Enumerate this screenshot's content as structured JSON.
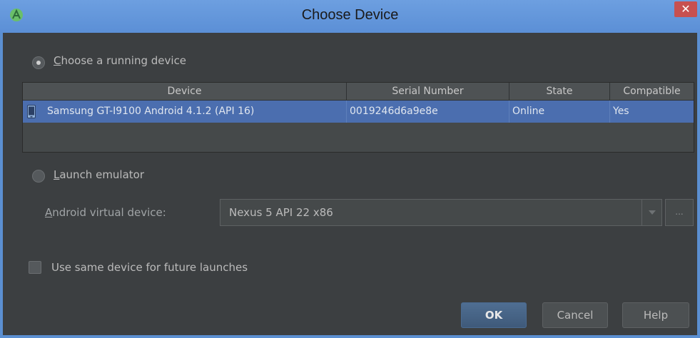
{
  "window": {
    "title": "Choose Device",
    "close_glyph": "✕",
    "accent_color": "#5b8fd1"
  },
  "running": {
    "label_first": "C",
    "label_rest": "hoose a running device",
    "selected": true
  },
  "table": {
    "columns": [
      "Device",
      "Serial Number",
      "State",
      "Compatible"
    ],
    "rows": [
      {
        "icon": "phone-icon",
        "device": "Samsung GT-I9100 Android 4.1.2 (API 16)",
        "serial": "0019246d6a9e8e",
        "state": "Online",
        "compatible": "Yes"
      }
    ],
    "selection_color": "#4b6eaf"
  },
  "emulator": {
    "label_first": "L",
    "label_rest": "aunch emulator",
    "selected": false,
    "avd_label_first": "A",
    "avd_label_rest": "ndroid virtual device:",
    "avd_value": "Nexus 5 API 22 x86",
    "more_label": "..."
  },
  "future": {
    "label": "Use same device for future launches",
    "checked": false
  },
  "buttons": {
    "ok": "OK",
    "cancel": "Cancel",
    "help": "Help"
  }
}
